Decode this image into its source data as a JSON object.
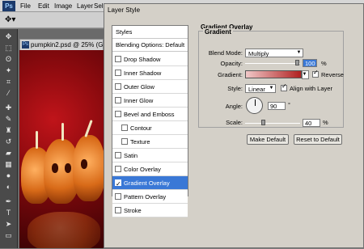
{
  "menubar": {
    "logo": "Ps",
    "items": [
      "File",
      "Edit",
      "Image",
      "Layer",
      "Sele"
    ]
  },
  "options_bar": {
    "tool_icon": "move-tool-icon"
  },
  "document": {
    "tab_icon": "Ps",
    "tab_title": "pumpkin2.psd @ 25% (Gra"
  },
  "dialog": {
    "title": "Layer Style",
    "style_list": {
      "header": "Styles",
      "blending": "Blending Options: Default",
      "items": [
        {
          "label": "Drop Shadow",
          "checked": false,
          "indent": false
        },
        {
          "label": "Inner Shadow",
          "checked": false,
          "indent": false
        },
        {
          "label": "Outer Glow",
          "checked": false,
          "indent": false
        },
        {
          "label": "Inner Glow",
          "checked": false,
          "indent": false
        },
        {
          "label": "Bevel and Emboss",
          "checked": false,
          "indent": false
        },
        {
          "label": "Contour",
          "checked": false,
          "indent": true
        },
        {
          "label": "Texture",
          "checked": false,
          "indent": true
        },
        {
          "label": "Satin",
          "checked": false,
          "indent": false
        },
        {
          "label": "Color Overlay",
          "checked": false,
          "indent": false
        },
        {
          "label": "Gradient Overlay",
          "checked": true,
          "indent": false,
          "selected": true
        },
        {
          "label": "Pattern Overlay",
          "checked": false,
          "indent": false
        },
        {
          "label": "Stroke",
          "checked": false,
          "indent": false
        }
      ]
    },
    "panel": {
      "title": "Gradient Overlay",
      "group_title": "Gradient",
      "blend_mode_label": "Blend Mode:",
      "blend_mode_value": "Multiply",
      "opacity_label": "Opacity:",
      "opacity_value": "100",
      "opacity_unit": "%",
      "gradient_label": "Gradient:",
      "reverse_label": "Reverse",
      "reverse_checked": true,
      "style_label": "Style:",
      "style_value": "Linear",
      "align_label": "Align with Layer",
      "align_checked": true,
      "angle_label": "Angle:",
      "angle_value": "90",
      "angle_unit": "°",
      "scale_label": "Scale:",
      "scale_value": "40",
      "scale_unit": "%",
      "make_default": "Make Default",
      "reset_default": "Reset to Default"
    }
  },
  "colors": {
    "selection": "#3a78d6",
    "dialog_bg": "#d4d0c8",
    "canvas_red": "#c0141a"
  }
}
